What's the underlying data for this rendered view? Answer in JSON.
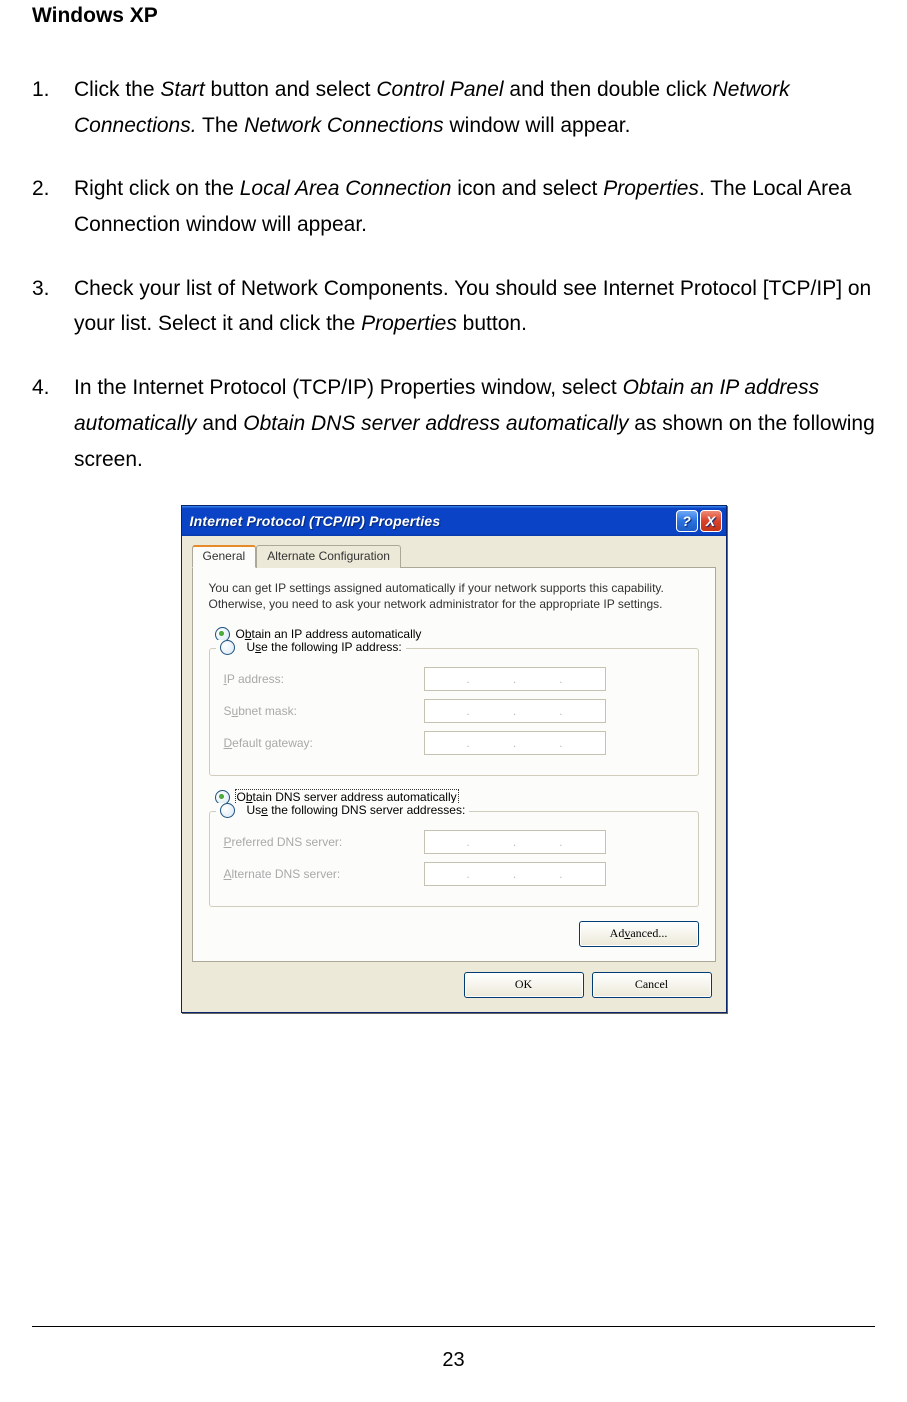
{
  "doc": {
    "heading": "Windows XP",
    "steps": [
      {
        "num": "1.",
        "parts": [
          {
            "t": "Click the "
          },
          {
            "t": "Start",
            "i": true
          },
          {
            "t": " button and select "
          },
          {
            "t": "Control Panel",
            "i": true
          },
          {
            "t": " and then double click "
          },
          {
            "t": "Network Connections.",
            "i": true
          },
          {
            "t": " The "
          },
          {
            "t": "Network Connections",
            "i": true
          },
          {
            "t": " window will appear."
          }
        ]
      },
      {
        "num": "2.",
        "parts": [
          {
            "t": "Right click on the "
          },
          {
            "t": "Local Area Connection",
            "i": true
          },
          {
            "t": " icon and select "
          },
          {
            "t": "Properties",
            "i": true
          },
          {
            "t": ". The Local Area Connection window will appear."
          }
        ]
      },
      {
        "num": "3.",
        "parts": [
          {
            "t": "Check your list of Network Components. You should see Internet Protocol [TCP/IP] on your list. Select it and click the "
          },
          {
            "t": "Properties",
            "i": true
          },
          {
            "t": " button."
          }
        ]
      },
      {
        "num": "4.",
        "parts": [
          {
            "t": "In the Internet Protocol (TCP/IP) Properties window, select "
          },
          {
            "t": "Obtain an IP address automatically",
            "i": true
          },
          {
            "t": " and "
          },
          {
            "t": "Obtain DNS server address automatically",
            "i": true
          },
          {
            "t": " as shown on the following screen."
          }
        ]
      }
    ],
    "page_number": "23"
  },
  "dialog": {
    "title": "Internet Protocol (TCP/IP) Properties",
    "help_btn": "?",
    "close_btn": "X",
    "tabs": {
      "general": "General",
      "alt": "Alternate Configuration"
    },
    "desc": "You can get IP settings assigned automatically if your network supports this capability. Otherwise, you need to ask your network administrator for the appropriate IP settings.",
    "ip": {
      "auto_pre": "O",
      "auto_u": "b",
      "auto_post": "tain an IP address automatically",
      "manual_pre": "U",
      "manual_u": "s",
      "manual_post": "e the following IP address:",
      "addr_u": "I",
      "addr_post": "P address:",
      "mask_pre": "S",
      "mask_u": "u",
      "mask_post": "bnet mask:",
      "gw_u": "D",
      "gw_post": "efault gateway:"
    },
    "dns": {
      "auto_pre": "O",
      "auto_u": "b",
      "auto_post": "tain DNS server address automatically",
      "manual_pre": "Us",
      "manual_u": "e",
      "manual_post": " the following DNS server addresses:",
      "pref_u": "P",
      "pref_post": "referred DNS server:",
      "alt_u": "A",
      "alt_post": "lternate DNS server:"
    },
    "advanced_pre": "Ad",
    "advanced_u": "v",
    "advanced_post": "anced...",
    "ok": "OK",
    "cancel": "Cancel",
    "dots": "."
  }
}
